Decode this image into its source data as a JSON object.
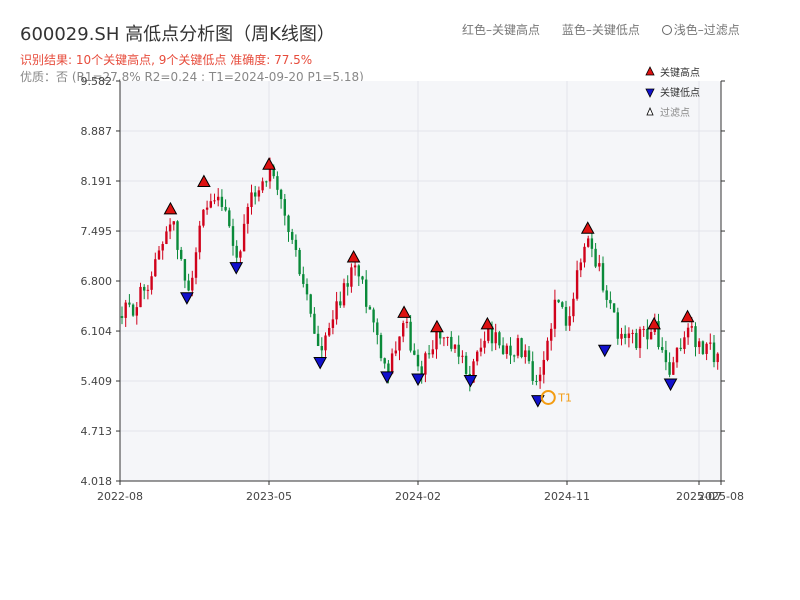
{
  "header": {
    "title": "600029.SH 高低点分析图（周K线图）",
    "subtitle_line1": "识别结果: 10个关键高点, 9个关键低点  准确度: 77.5%",
    "subtitle_line2": "优质：否  (R1=27.8%  R2=0.24 ; T1=2024-09-20 P1=5.18)"
  },
  "top_legend": {
    "red_label": "红色–关键高点",
    "blue_label": "蓝色–关键低点",
    "filtered_label": "浅色–过滤点"
  },
  "colors": {
    "up": "#d0021b",
    "down": "#0a8a3a",
    "high_marker": "#dd1111",
    "low_marker": "#1111cc",
    "plot_bg": "#f5f6f9",
    "grid": "#e2e4ea",
    "t1_circle": "#f39c12",
    "axis": "#333333"
  },
  "chart_data": {
    "type": "candlestick",
    "y_axis": {
      "min": 4.018,
      "max": 9.582,
      "ticks": [
        "9.582",
        "8.887",
        "8.191",
        "7.495",
        "6.800",
        "6.104",
        "5.409",
        "4.713",
        "4.018"
      ]
    },
    "x_axis": {
      "ticks": [
        {
          "label": "2022-08",
          "date": "2022-08"
        },
        {
          "label": "2023-05",
          "date": "2023-05"
        },
        {
          "label": "2024-02",
          "date": "2024-02"
        },
        {
          "label": "2024-11",
          "date": "2024-11"
        },
        {
          "label": "2025-07",
          "date": "2025-07"
        },
        {
          "label": "2025-08",
          "date": "2025-08"
        }
      ]
    },
    "legend": {
      "position": "top-right",
      "items": [
        {
          "label": "关键高点",
          "symbol": "triangle-up"
        },
        {
          "label": "关键低点",
          "symbol": "triangle-down"
        },
        {
          "label": "过滤点",
          "symbol": "triangle-up-hollow"
        }
      ]
    },
    "anchors": [
      {
        "date": "2022-08",
        "price": 6.3
      },
      {
        "date": "2022-09",
        "price": 6.5
      },
      {
        "date": "2022-10",
        "price": 6.95
      },
      {
        "date": "2022-11",
        "price": 7.72
      },
      {
        "date": "2022-12",
        "price": 6.65
      },
      {
        "date": "2023-01",
        "price": 7.7
      },
      {
        "date": "2023-02",
        "price": 7.9
      },
      {
        "date": "2023-03",
        "price": 7.07
      },
      {
        "date": "2023-04",
        "price": 8.0
      },
      {
        "date": "2023-05",
        "price": 8.34
      },
      {
        "date": "2023-06",
        "price": 7.6
      },
      {
        "date": "2023-07",
        "price": 6.8
      },
      {
        "date": "2023-08",
        "price": 5.75
      },
      {
        "date": "2023-09",
        "price": 6.4
      },
      {
        "date": "2023-10",
        "price": 7.05
      },
      {
        "date": "2023-11",
        "price": 6.4
      },
      {
        "date": "2023-12",
        "price": 5.55
      },
      {
        "date": "2024-01",
        "price": 6.28
      },
      {
        "date": "2024-02",
        "price": 5.52
      },
      {
        "date": "2024-03",
        "price": 6.08
      },
      {
        "date": "2024-04",
        "price": 5.8
      },
      {
        "date": "2024-05",
        "price": 5.5
      },
      {
        "date": "2024-06",
        "price": 6.12
      },
      {
        "date": "2024-07",
        "price": 5.85
      },
      {
        "date": "2024-08",
        "price": 5.9
      },
      {
        "date": "2024-09",
        "price": 5.22
      },
      {
        "date": "2024-10",
        "price": 6.5
      },
      {
        "date": "2024-11",
        "price": 6.3
      },
      {
        "date": "2024-12",
        "price": 7.45
      },
      {
        "date": "2025-01",
        "price": 6.7
      },
      {
        "date": "2025-02",
        "price": 5.95
      },
      {
        "date": "2025-03",
        "price": 6.0
      },
      {
        "date": "2025-04",
        "price": 6.15
      },
      {
        "date": "2025-05",
        "price": 5.45
      },
      {
        "date": "2025-06",
        "price": 6.22
      },
      {
        "date": "2025-07",
        "price": 5.85
      },
      {
        "date": "2025-08",
        "price": 5.78
      }
    ],
    "key_highs": [
      {
        "date": "2022-11",
        "price": 7.72
      },
      {
        "date": "2023-01",
        "price": 8.1
      },
      {
        "date": "2023-05",
        "price": 8.34
      },
      {
        "date": "2023-10",
        "price": 7.05
      },
      {
        "date": "2024-01",
        "price": 6.28
      },
      {
        "date": "2024-03",
        "price": 6.08
      },
      {
        "date": "2024-06",
        "price": 6.12
      },
      {
        "date": "2024-12",
        "price": 7.45
      },
      {
        "date": "2025-04",
        "price": 6.12
      },
      {
        "date": "2025-06",
        "price": 6.22
      }
    ],
    "key_lows": [
      {
        "date": "2022-12",
        "price": 6.65
      },
      {
        "date": "2023-03",
        "price": 7.07
      },
      {
        "date": "2023-08",
        "price": 5.75
      },
      {
        "date": "2023-12",
        "price": 5.55
      },
      {
        "date": "2024-02",
        "price": 5.52
      },
      {
        "date": "2024-05",
        "price": 5.5
      },
      {
        "date": "2024-09",
        "price": 5.22
      },
      {
        "date": "2025-01",
        "price": 5.92
      },
      {
        "date": "2025-05",
        "price": 5.45
      }
    ],
    "t1_point": {
      "date": "2024-09-20",
      "price": 5.18,
      "label": "T1"
    }
  }
}
